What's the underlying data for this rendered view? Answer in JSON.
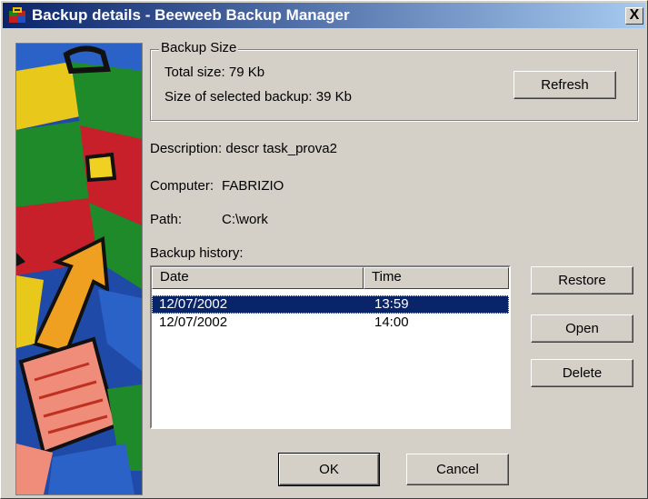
{
  "window": {
    "title": "Backup details - Beeweeb Backup Manager",
    "close_label": "X"
  },
  "backup_size": {
    "legend": "Backup Size",
    "total_size": "Total size: 79 Kb",
    "selected_size": "Size of selected backup: 39 Kb",
    "refresh_label": "Refresh"
  },
  "details": {
    "description": "Description: descr task_prova2",
    "computer_label": "Computer:",
    "computer_value": "FABRIZIO",
    "path_label": "Path:",
    "path_value": "C:\\work"
  },
  "history": {
    "label": "Backup history:",
    "columns": [
      "Date",
      "Time"
    ],
    "rows": [
      {
        "date": "12/07/2002",
        "time": "13:59",
        "selected": true
      },
      {
        "date": "12/07/2002",
        "time": "14:00",
        "selected": false
      }
    ]
  },
  "actions": {
    "restore_label": "Restore",
    "open_label": "Open",
    "delete_label": "Delete",
    "ok_label": "OK",
    "cancel_label": "Cancel"
  }
}
